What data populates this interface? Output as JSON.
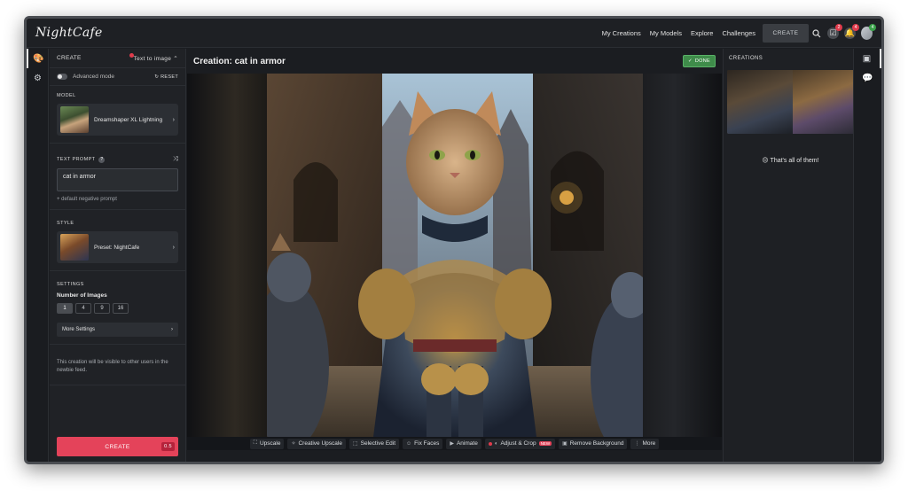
{
  "app": {
    "logo": "NightCafe"
  },
  "topbar": {
    "nav": [
      "My Creations",
      "My Models",
      "Explore",
      "Challenges"
    ],
    "create_label": "CREATE",
    "badges": {
      "tasks": "2",
      "notifications": "4",
      "avatar": "4"
    }
  },
  "left": {
    "create_label": "CREATE",
    "mode_label": "Text to image ⌃",
    "advanced_label": "Advanced mode",
    "reset_label": "↻ RESET",
    "model_title": "MODEL",
    "model_name": "Dreamshaper XL Lightning",
    "prompt_title": "TEXT PROMPT",
    "prompt_value": "cat in armor",
    "negative_label": "+ default negative prompt",
    "style_title": "STYLE",
    "style_name": "Preset: NightCafe",
    "settings_title": "SETTINGS",
    "num_images_label": "Number of Images",
    "num_options": [
      "1",
      "4",
      "9",
      "16"
    ],
    "num_selected": "1",
    "more_settings_label": "More Settings",
    "visibility_note": "This creation will be visible to other users in the newbie feed.",
    "create_button": "CREATE",
    "cost": "0.5"
  },
  "main": {
    "title": "Creation: cat in armor",
    "done_label": "DONE",
    "tools": [
      {
        "icon": "upscale-icon",
        "glyph": "⛶",
        "label": "Upscale"
      },
      {
        "icon": "creative-upscale-icon",
        "glyph": "✧",
        "label": "Creative Upscale"
      },
      {
        "icon": "selective-edit-icon",
        "glyph": "⬚",
        "label": "Selective Edit"
      },
      {
        "icon": "fix-faces-icon",
        "glyph": "☺",
        "label": "Fix Faces"
      },
      {
        "icon": "animate-icon",
        "glyph": "▶",
        "label": "Animate"
      },
      {
        "icon": "adjust-crop-icon",
        "glyph": "◐",
        "label": "Adjust & Crop",
        "tag": "NEW"
      },
      {
        "icon": "remove-background-icon",
        "glyph": "▣",
        "label": "Remove Background"
      },
      {
        "icon": "more-icon",
        "glyph": "⋮",
        "label": "More"
      }
    ]
  },
  "right": {
    "title": "CREATIONS",
    "end_message": "😔 That's all of them!"
  },
  "colors": {
    "accent": "#e4435a",
    "done_green": "#3f8c4a",
    "bg": "#1b1d21"
  }
}
